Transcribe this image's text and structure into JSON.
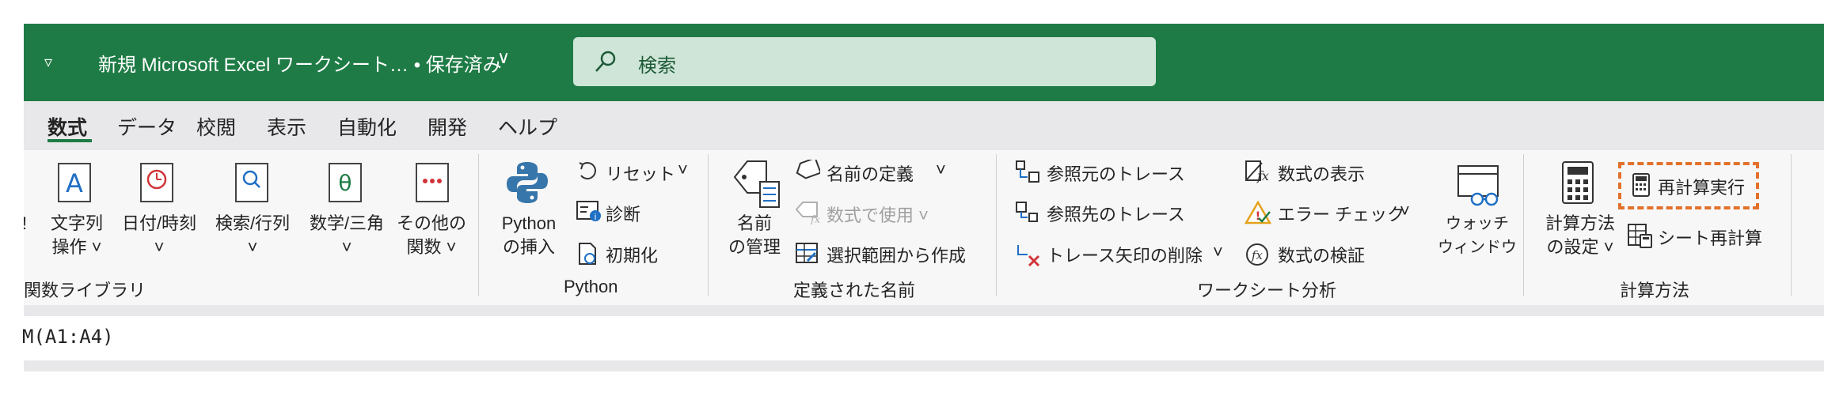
{
  "titlebar": {
    "qat_icon": "customize-quick-access-icon",
    "doc_title": "新規 Microsoft Excel ワークシート… • 保存済み",
    "doc_chevron": "∨",
    "search_placeholder": "検索"
  },
  "tabs": [
    "数式",
    "データ",
    "校閲",
    "表示",
    "自動化",
    "開発",
    "ヘルプ"
  ],
  "ribbon": {
    "library": {
      "text_l1": "文字列",
      "text_l2": "操作 ˅",
      "date_l1": "日付/時刻",
      "date_l2": "˅",
      "lookup_l1": "検索/行列",
      "lookup_l2": "˅",
      "math_l1": "数学/三角",
      "math_l2": "˅",
      "more_l1": "その他の",
      "more_l2": "関数 ˅",
      "partial": "!",
      "group": "関数ライブラリ"
    },
    "python": {
      "insert_l1": "Python",
      "insert_l2": "の挿入",
      "reset": "リセット",
      "reset_chev": "˅",
      "diagnose": "診断",
      "initialize": "初期化",
      "group": "Python"
    },
    "names": {
      "manager_l1": "名前",
      "manager_l2": "の管理",
      "define": "名前の定義",
      "define_chev": "˅",
      "use": "数式で使用 ˅",
      "create": "選択範囲から作成",
      "group": "定義された名前"
    },
    "audit": {
      "trace_precedents": "参照元のトレース",
      "trace_dependents": "参照先のトレース",
      "remove_arrows": "トレース矢印の削除",
      "remove_chev": "˅",
      "show_formulas": "数式の表示",
      "error_check": "エラー チェック",
      "error_chev": "˅",
      "evaluate": "数式の検証",
      "watch_l1": "ウォッチ",
      "watch_l2": "ウィンドウ",
      "group": "ワークシート分析"
    },
    "calc": {
      "options_l1": "計算方法",
      "options_l2": "の設定 ˅",
      "calc_now": "再計算実行",
      "calc_sheet": "シート再計算",
      "group": "計算方法"
    }
  },
  "formula_bar": {
    "text": "M(A1:A4)"
  },
  "colors": {
    "titlebar": "#1e7b45",
    "search_bg": "#cfe5d8",
    "highlight": "#e3712b",
    "ribbon_bg": "#f7f7f8"
  }
}
